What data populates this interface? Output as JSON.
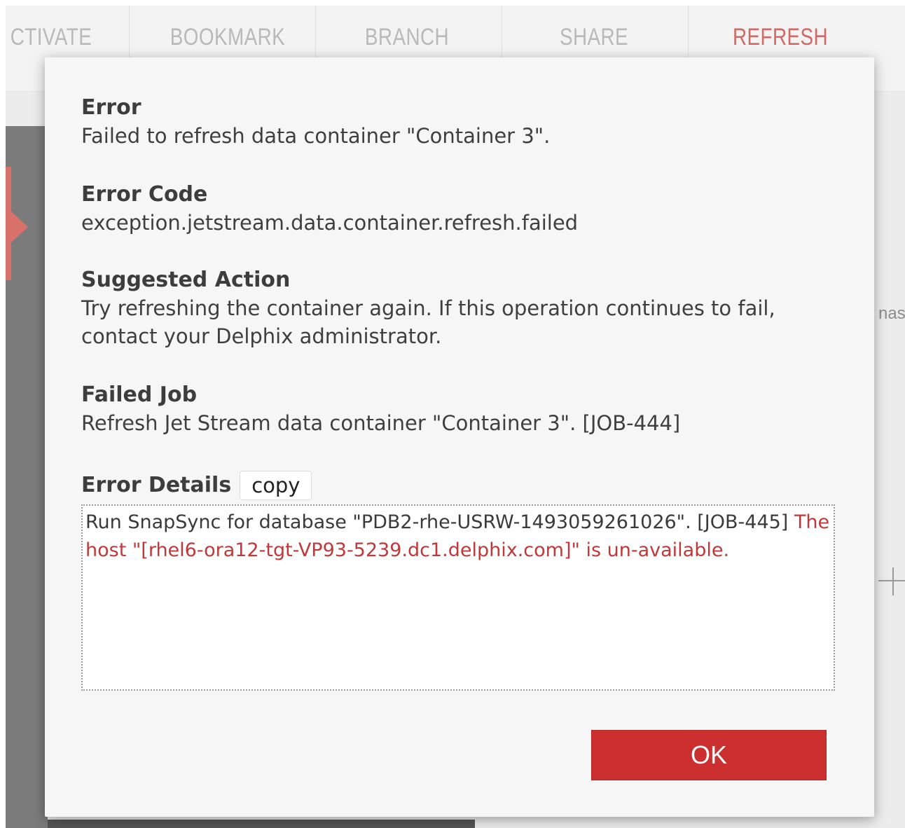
{
  "toolbar": {
    "tabs": [
      {
        "label": "CTIVATE"
      },
      {
        "label": "BOOKMARK"
      },
      {
        "label": "BRANCH"
      },
      {
        "label": "SHARE"
      },
      {
        "label": "REFRESH"
      }
    ],
    "active_tab": "REFRESH"
  },
  "background": {
    "right_fragment": "nas"
  },
  "dialog": {
    "error": {
      "heading": "Error",
      "text": "Failed to refresh data container \"Container 3\"."
    },
    "error_code": {
      "heading": "Error Code",
      "text": "exception.jetstream.data.container.refresh.failed"
    },
    "suggested_action": {
      "heading": "Suggested Action",
      "text": "Try refreshing the container again. If this operation continues to fail, contact your Delphix administrator."
    },
    "failed_job": {
      "heading": "Failed Job",
      "text": "Refresh Jet Stream data container \"Container 3\". [JOB-444]"
    },
    "error_details": {
      "heading": "Error Details",
      "copy_label": "copy",
      "line_plain": "Run SnapSync for database \"PDB2-rhe-USRW-1493059261026\". [JOB-445]",
      "line_error": "The host \"[rhel6-ora12-tgt-VP93-5239.dc1.delphix.com]\" is un-available."
    },
    "ok_label": "OK"
  },
  "colors": {
    "accent_red": "#cc2f2f",
    "active_tab": "#d06a66",
    "error_text": "#c0393a"
  }
}
